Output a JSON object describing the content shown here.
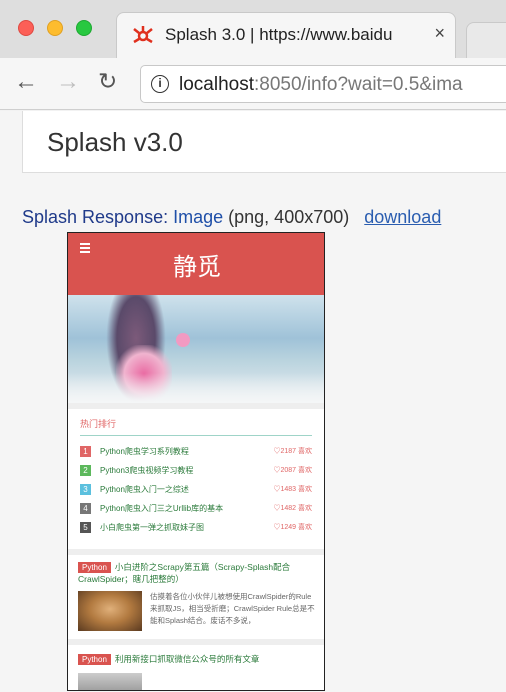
{
  "browser": {
    "tab_title": "Splash 3.0 | https://www.baidu",
    "close_glyph": "×",
    "url_host": "localhost",
    "url_rest": ":8050/info?wait=0.5&ima",
    "nav": {
      "back": "←",
      "forward": "→",
      "reload": "↻"
    },
    "info_glyph": "i"
  },
  "page": {
    "heading": "Splash v3.0",
    "response_label": "Splash Response:",
    "response_type": "Image",
    "response_meta": "(png, 400x700)",
    "download": "download"
  },
  "rendered": {
    "site_title": "静觅",
    "hot_title": "热门排行",
    "rankings": [
      {
        "num": "1",
        "text": "Python爬虫学习系列教程",
        "likes": "♡2187 喜欢",
        "color": "#e06666"
      },
      {
        "num": "2",
        "text": "Python3爬虫视频学习教程",
        "likes": "♡2087 喜欢",
        "color": "#5cb85c"
      },
      {
        "num": "3",
        "text": "Python爬虫入门一之综述",
        "likes": "♡1483 喜欢",
        "color": "#5bc0de"
      },
      {
        "num": "4",
        "text": "Python爬虫入门三之Urllib库的基本",
        "likes": "♡1482 喜欢",
        "color": "#777777"
      },
      {
        "num": "5",
        "text": "小白爬虫第一弹之抓取妹子图",
        "likes": "♡1249 喜欢",
        "color": "#555555"
      }
    ],
    "articles": [
      {
        "tag": "Python",
        "title": "小白进阶之Scrapy第五篇（Scrapy-Splash配合CrawlSpider；瞎几把整的）",
        "desc": "估摸着各位小伙伴儿被想使用CrawlSpider的Rule来抓取JS，相当受折磨；CrawlSpider Rule总是不能和Splash结合。废话不多说，"
      },
      {
        "tag": "Python",
        "title": "利用新接口抓取微信公众号的所有文章"
      }
    ]
  },
  "colors": {
    "brand_red": "#d9534f",
    "link_blue": "#2a5db0"
  }
}
